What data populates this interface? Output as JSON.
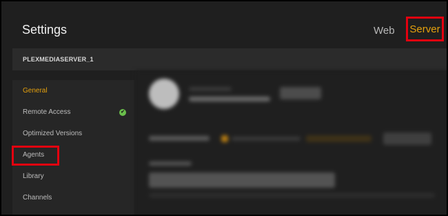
{
  "header": {
    "title": "Settings",
    "tabs": [
      {
        "label": "Web",
        "active": false
      },
      {
        "label": "Server",
        "active": true
      }
    ]
  },
  "server": {
    "name": "PLEXMEDIASERVER_1"
  },
  "sidebar": {
    "items": [
      {
        "label": "General",
        "active": true
      },
      {
        "label": "Remote Access",
        "status_icon": "check-circle-icon"
      },
      {
        "label": "Optimized Versions"
      },
      {
        "label": "Agents",
        "highlighted": true
      },
      {
        "label": "Library"
      },
      {
        "label": "Channels"
      }
    ]
  },
  "colors": {
    "accent": "#e5a00d",
    "highlight_box": "#e4000f",
    "status_ok": "#6abf4b",
    "background": "#1f1f1f",
    "panel": "#262626"
  }
}
